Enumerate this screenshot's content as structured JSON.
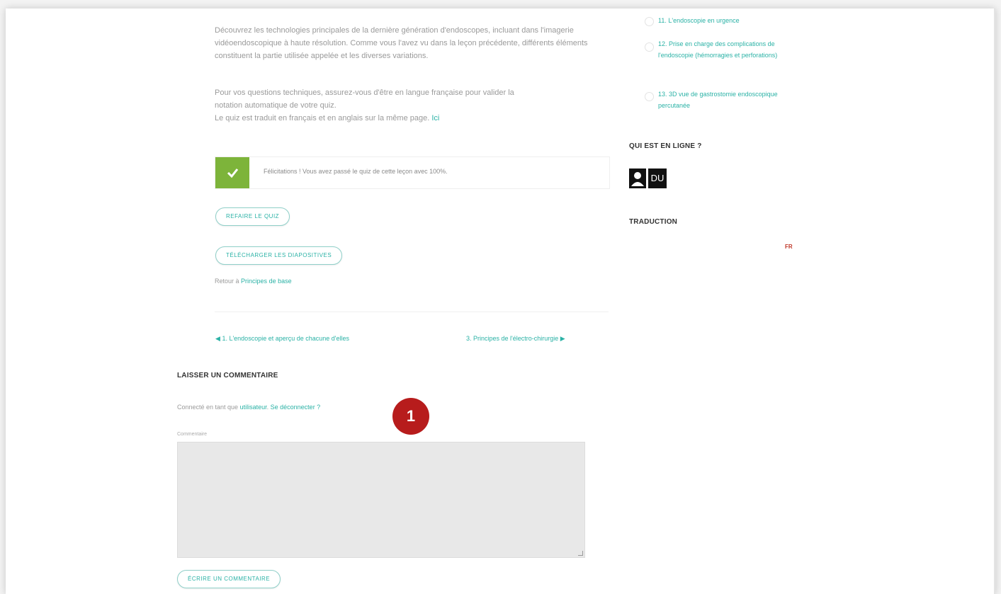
{
  "content": {
    "paragraph1": "Découvrez les technologies principales de la dernière génération d'endoscopes, incluant dans l'imagerie vidéoendoscopique à haute résolution. Comme vous l'avez vu dans la leçon précédente, différents éléments constituent la partie utilisée appelée et les diverses variations.",
    "paragraph2_line1": "Pour vos questions techniques, assurez-vous d'être en langue française pour valider la",
    "paragraph2_line2": "notation automatique de votre quiz.",
    "paragraph2_line3": "Le quiz est traduit en français et en anglais sur la même page.",
    "paragraph2_link": "Ici",
    "success_message": "Félicitations ! Vous avez passé le quiz de cette leçon avec 100%.",
    "buttons": {
      "quiz": "Refaire le quiz",
      "download": "Télécharger les diapositives"
    },
    "back_prefix": "Retour à",
    "back_link": "Principes de base",
    "nav_prev": "1. L'endoscopie et aperçu de chacune d'elles",
    "nav_next": "3. Principes de l'électro-chirurgie"
  },
  "comments": {
    "heading": "Laisser un commentaire",
    "login_prefix": "Connecté en tant que",
    "login_user": "utilisateur",
    "login_link": "Se déconnecter ?",
    "textarea_label": "Commentaire",
    "submit_label": "Écrire un commentaire"
  },
  "sidebar": {
    "lessons": [
      {
        "label": "11. L'endoscopie en urgence"
      },
      {
        "label": "12. Prise en charge des complications de l'endoscopie (hémorragies et perforations)"
      },
      {
        "label": "13. 3D vue de gastrostomie endoscopique percutanée"
      }
    ],
    "online_title": "Qui est en ligne ?",
    "avatar_initials": "DU",
    "translation_title": "Traduction",
    "translation_code": "FR"
  },
  "marker": {
    "number": "1"
  },
  "colors": {
    "accent": "#2bb2a6",
    "success": "#7db43a",
    "marker": "#b71c1c"
  }
}
